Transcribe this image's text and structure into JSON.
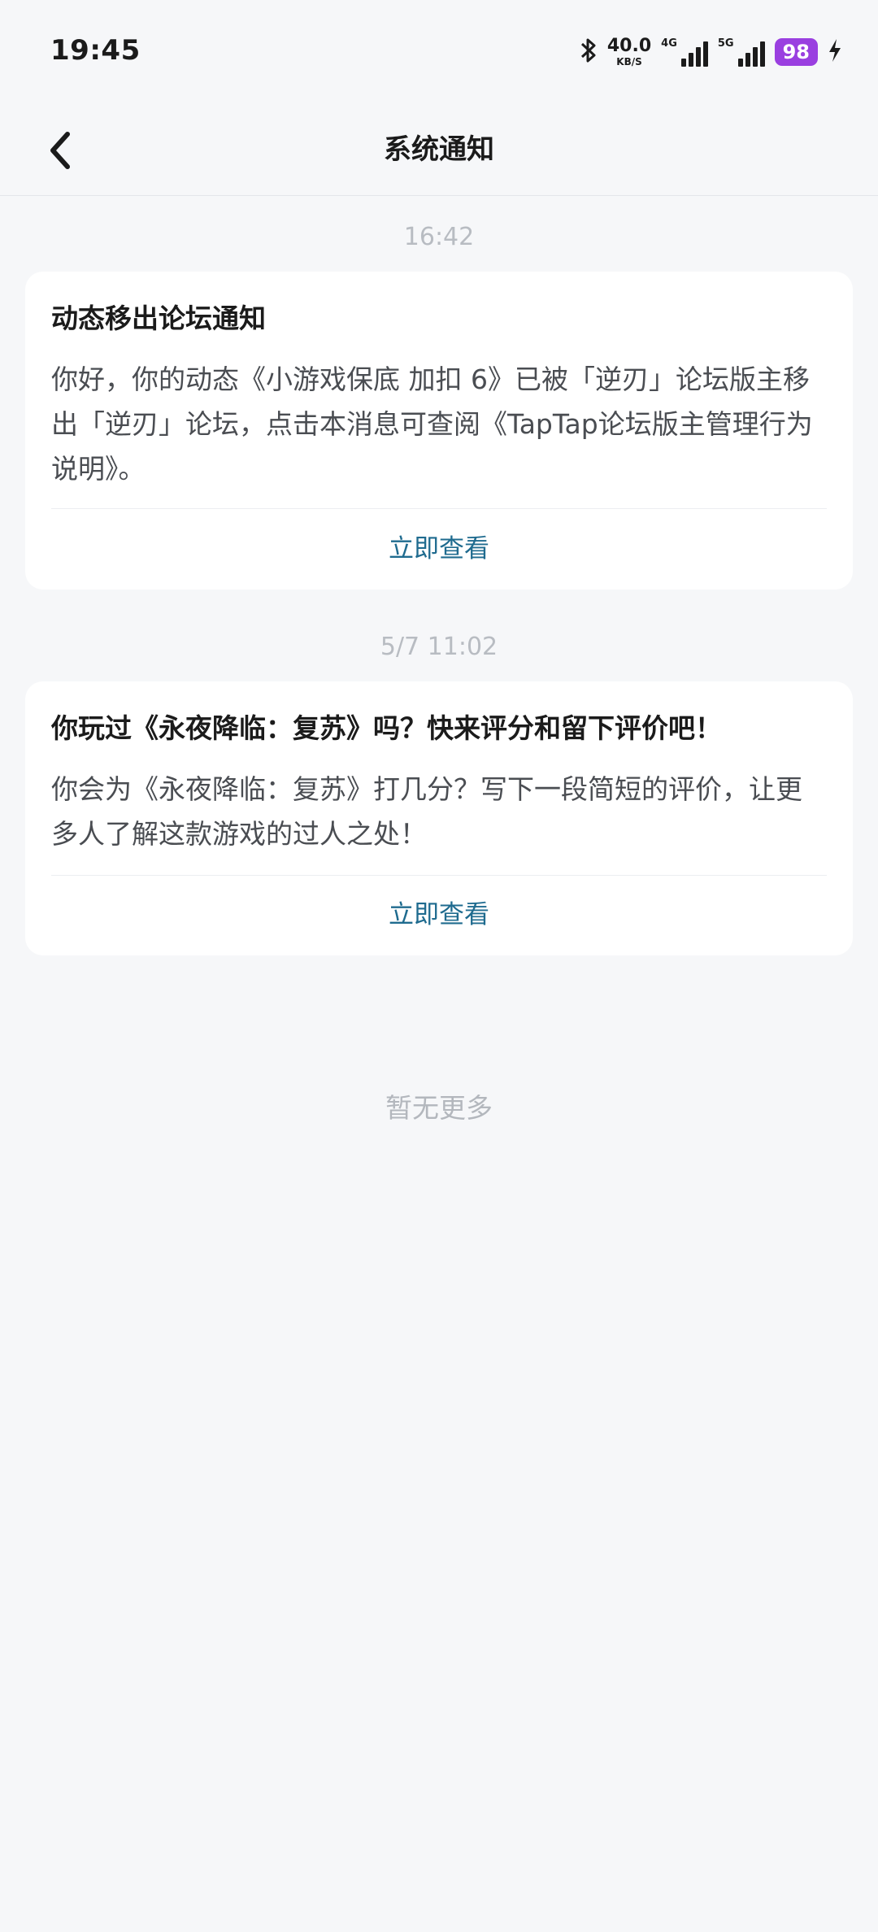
{
  "status_bar": {
    "time": "19:45",
    "net_speed_value": "40.0",
    "net_speed_unit": "KB/S",
    "signal1_label": "4G",
    "signal2_label": "5G",
    "battery": "98"
  },
  "header": {
    "title": "系统通知"
  },
  "notifications": [
    {
      "timestamp": "16:42",
      "title": "动态移出论坛通知",
      "body": "你好，你的动态《小游戏保底 加扣 6》已被「逆刃」论坛版主移出「逆刃」论坛，点击本消息可查阅《TapTap论坛版主管理行为说明》。",
      "action": "立即查看"
    },
    {
      "timestamp": "5/7  11:02",
      "title": "你玩过《永夜降临：复苏》吗？快来评分和留下评价吧！",
      "body": "你会为《永夜降临：复苏》打几分？写下一段简短的评价，让更多人了解这款游戏的过人之处！",
      "action": "立即查看"
    }
  ],
  "footer": {
    "no_more": "暂无更多"
  },
  "colors": {
    "background": "#f6f7f9",
    "action_link": "#1f6b8f",
    "battery": "#9a3fe0"
  }
}
